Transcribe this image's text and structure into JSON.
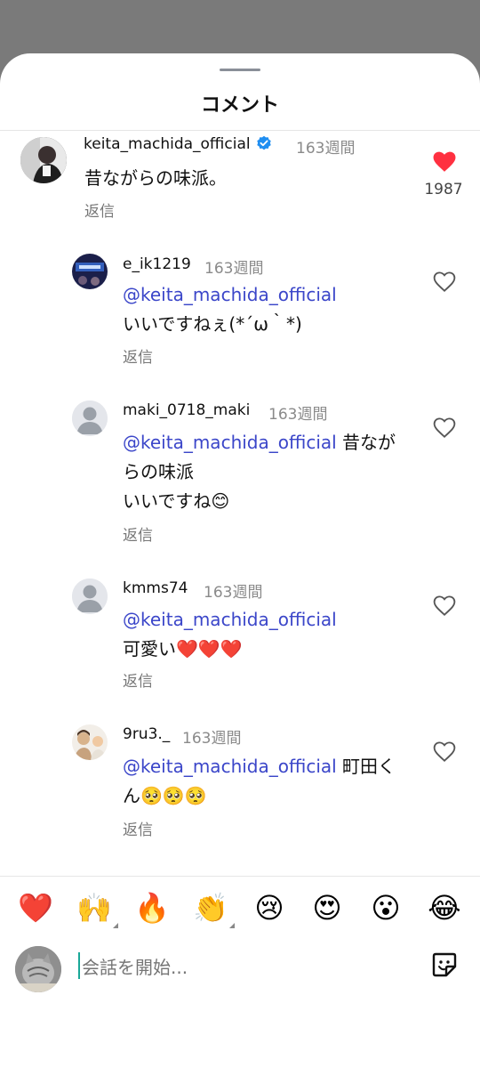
{
  "sheet": {
    "title": "コメント"
  },
  "comments": [
    {
      "username": "keita_machida_official",
      "time": "163週間",
      "verified": true,
      "text": "昔ながらの味派。",
      "reply": "返信",
      "likes": "1987",
      "liked": true
    },
    {
      "username": "e_ik1219",
      "time": "163週間",
      "mention": "@keita_machida_official",
      "text": "いいですねぇ(*´ω｀*)",
      "reply": "返信"
    },
    {
      "username": "maki_0718_maki",
      "time": "163週間",
      "mention": "@keita_machida_official",
      "text_inline": " 昔なが",
      "text_line2": "らの味派",
      "text_line3": "いいですね😊",
      "reply": "返信"
    },
    {
      "username": "kmms74",
      "time": "163週間",
      "mention": "@keita_machida_official",
      "text": "可愛い❤️❤️❤️",
      "reply": "返信"
    },
    {
      "username": "9ru3._",
      "time": "163週間",
      "mention": "@keita_machida_official",
      "text_inline": " 町田く",
      "text_line2": "ん🥺🥺🥺",
      "reply": "返信"
    }
  ],
  "emoji_bar": [
    "❤️",
    "🙌",
    "🔥",
    "👏",
    "😢",
    "😍",
    "😮",
    "😂"
  ],
  "input": {
    "placeholder": "会話を開始..."
  },
  "icons": {
    "heart_filled": "heart-filled-icon",
    "heart_outline": "heart-outline-icon",
    "verified": "verified-badge-icon",
    "sticker": "sticker-icon"
  },
  "colors": {
    "mention": "#3b46c9",
    "like_red": "#ff3040",
    "verified_blue": "#1f8ef1",
    "muted": "#8a8a8a"
  }
}
